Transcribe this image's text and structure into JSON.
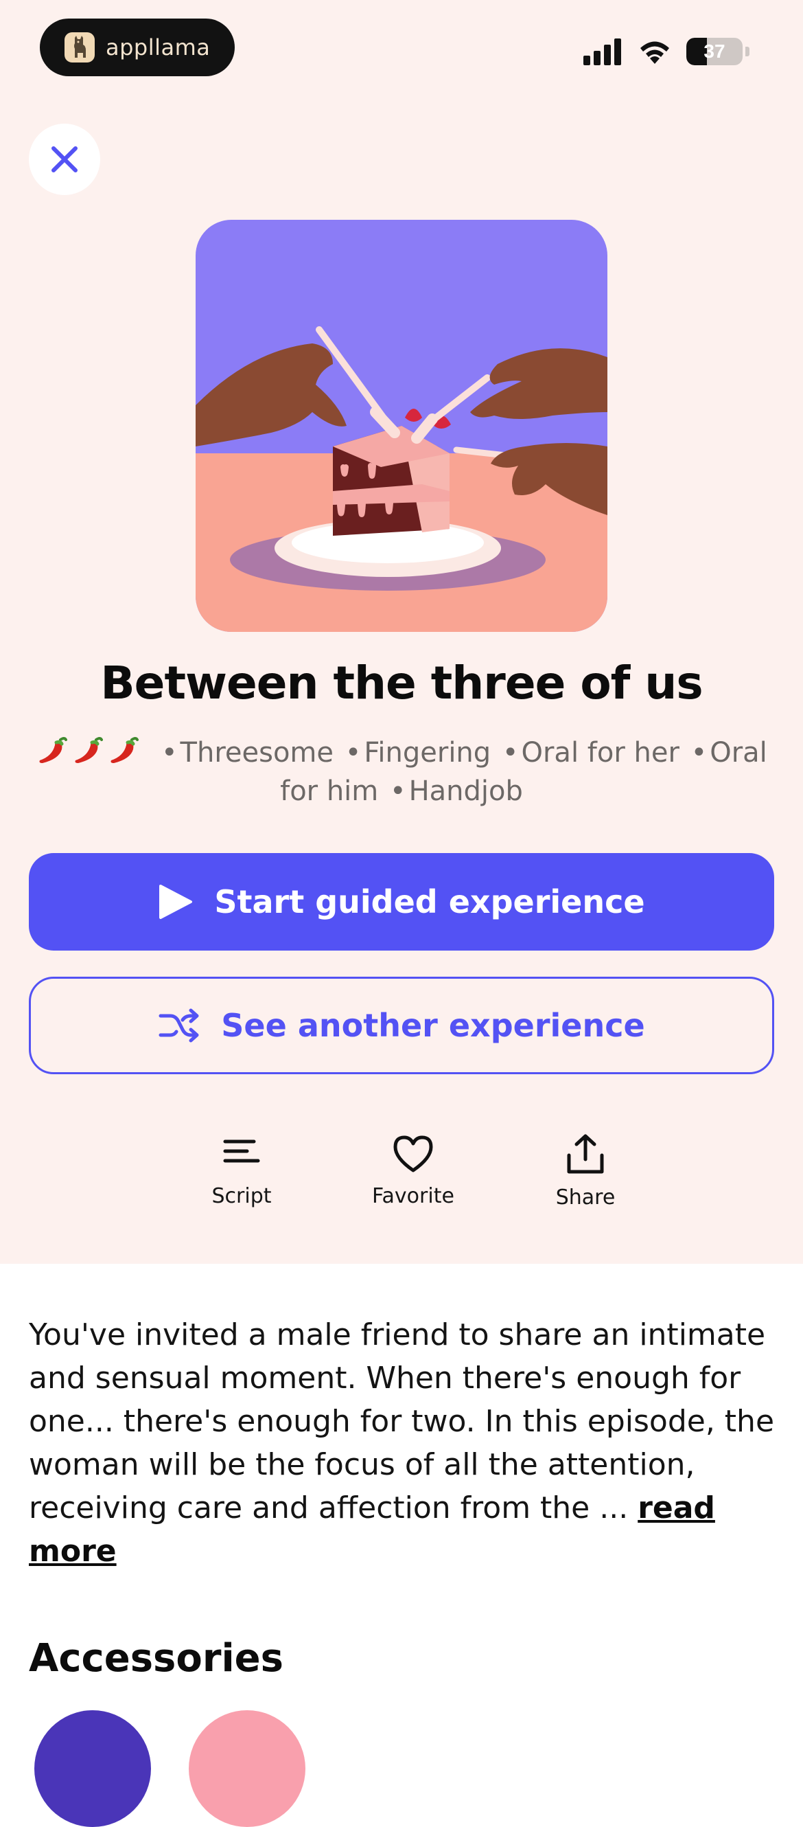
{
  "status_bar": {
    "app_name": "appllama",
    "battery_level": "37",
    "battery_fraction": 0.37
  },
  "header": {
    "close_icon": "close-icon"
  },
  "episode": {
    "title": "Between the three of us",
    "spice_level": 3,
    "spice_icon": "chili-pepper-icon",
    "tags": [
      "Threesome",
      "Fingering",
      "Oral for her",
      "Oral for him",
      "Handjob"
    ],
    "tag_separator": "•"
  },
  "buttons": {
    "start_label": "Start guided experience",
    "start_icon": "play-icon",
    "another_label": "See another experience",
    "another_icon": "shuffle-icon"
  },
  "actions": [
    {
      "label": "Script",
      "icon": "script-lines-icon"
    },
    {
      "label": "Favorite",
      "icon": "heart-icon"
    },
    {
      "label": "Share",
      "icon": "share-icon"
    }
  ],
  "description": {
    "text": "You've invited a male friend to share an intimate and sensual moment. When there's enough for one... there's enough for two. In this episode, the woman will be the focus of all the attention, receiving care and affection from the ... ",
    "read_more": "read more"
  },
  "accessories": {
    "title": "Accessories"
  },
  "colors": {
    "accent": "#5352f4",
    "background_top": "#fdf1ee",
    "art_purple": "#8b7cf6",
    "art_peach": "#f9a493"
  }
}
